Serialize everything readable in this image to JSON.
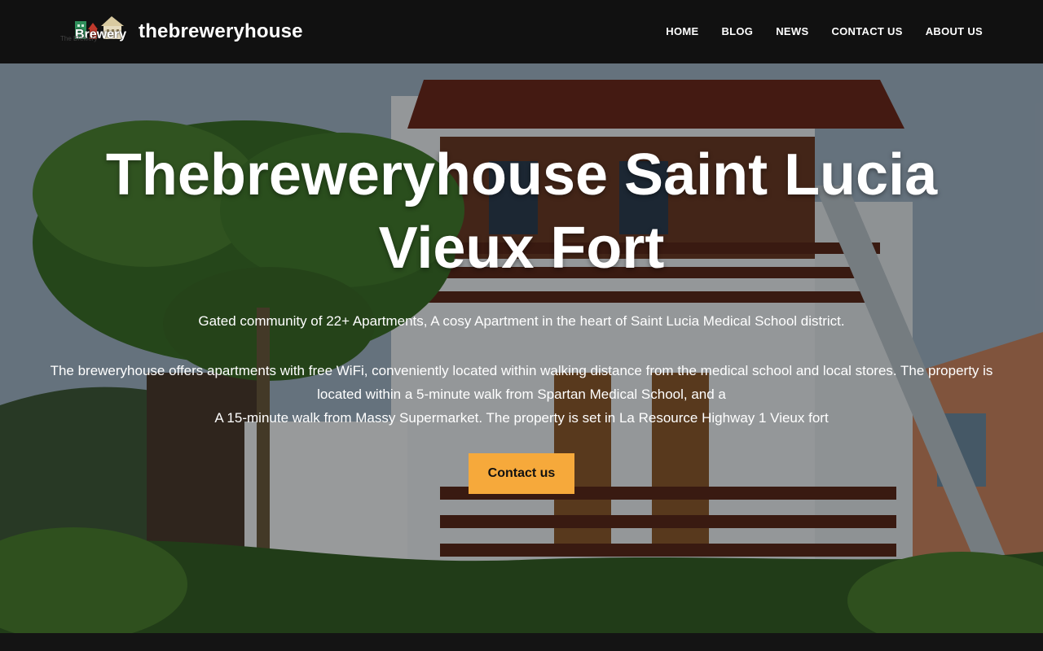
{
  "header": {
    "logo_text": "Brewery",
    "logo_subtext": "The Brewery",
    "site_title": "thebreweryhouse"
  },
  "nav": {
    "items": [
      {
        "label": "HOME"
      },
      {
        "label": "BLOG"
      },
      {
        "label": "NEWS"
      },
      {
        "label": "CONTACT US"
      },
      {
        "label": "ABOUT US"
      }
    ]
  },
  "hero": {
    "title": "Thebreweryhouse Saint Lucia Vieux Fort",
    "lead": "Gated community of 22+ Apartments, A cosy Apartment in the heart of Saint Lucia Medical School district.",
    "desc_line1": "The breweryhouse offers apartments with free WiFi, conveniently located within walking distance from the medical school and local stores. The property is located within a 5-minute walk from Spartan Medical School, and a",
    "desc_line2": "A 15-minute walk from Massy Supermarket. The property is set in La Resource Highway 1 Vieux fort",
    "cta_label": "Contact us"
  },
  "colors": {
    "header_bg": "#111111",
    "accent": "#f6a93b",
    "text": "#ffffff"
  }
}
